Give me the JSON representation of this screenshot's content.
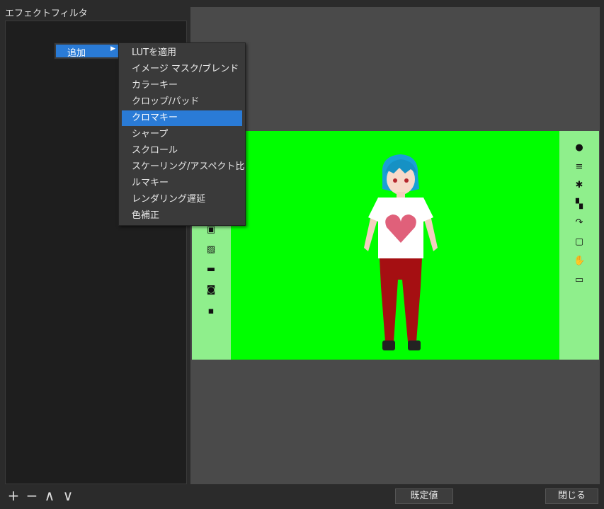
{
  "panel": {
    "title": "エフェクトフィルタ"
  },
  "context_menu": {
    "parent_label": "追加",
    "items": [
      "LUTを適用",
      "イメージ マスク/ブレンド",
      "カラーキー",
      "クロップ/パッド",
      "クロマキー",
      "シャープ",
      "スクロール",
      "スケーリング/アスペクト比",
      "ルマキー",
      "レンダリング遅延",
      "色補正"
    ],
    "selected": "クロマキー"
  },
  "preview": {
    "stage_color": "#8fef8c",
    "screen_color": "#00ff00",
    "left_icons": [
      "camera-stand-icon",
      "image-icon",
      "sofa-icon",
      "camera-icon",
      "video-camera-icon"
    ],
    "right_icons": [
      "person-icon",
      "sliders-icon",
      "gear-icon",
      "stand-icon",
      "rotate-icon",
      "portrait-icon",
      "hand-icon",
      "book-icon"
    ]
  },
  "bottom_bar": {
    "add_icon": "+",
    "remove_icon": "−",
    "up_icon": "∧",
    "down_icon": "∨",
    "defaults_label": "既定値",
    "close_label": "閉じる"
  },
  "colors": {
    "accent": "#2a7bd6",
    "background": "#2b2b2b"
  }
}
